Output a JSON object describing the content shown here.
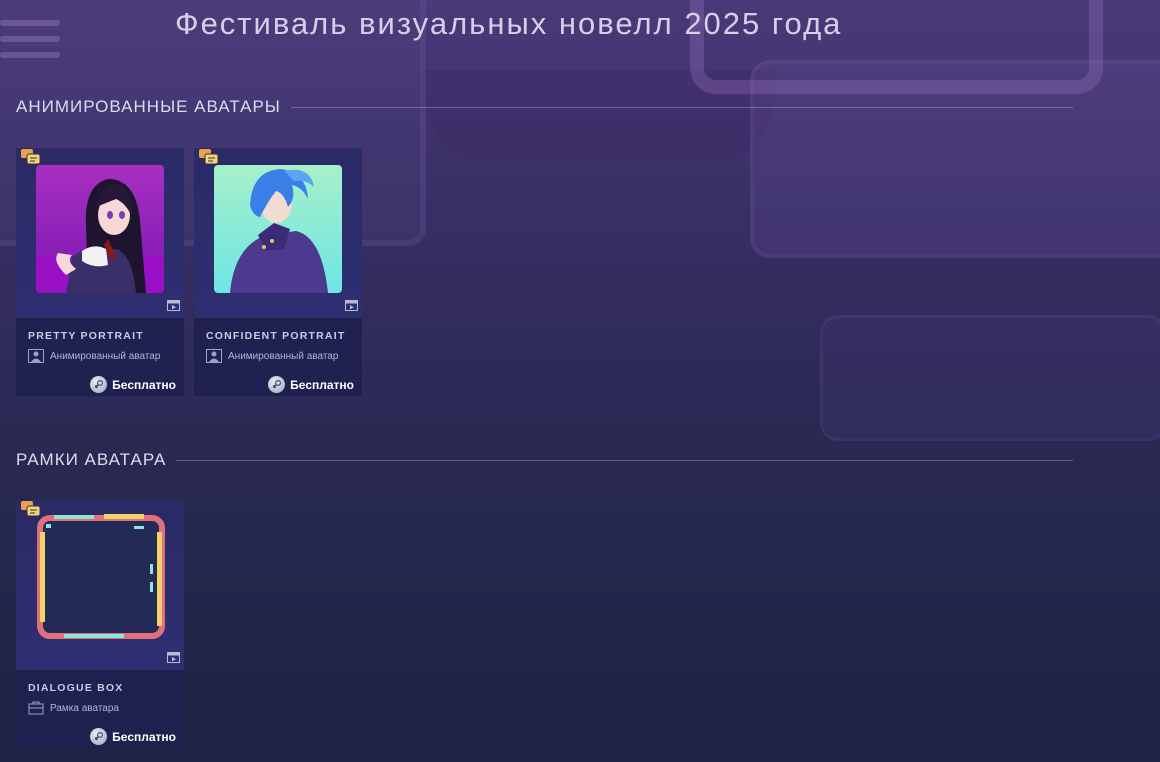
{
  "page": {
    "title": "Фестиваль визуальных новелл 2025 года"
  },
  "sections": [
    {
      "heading": "АНИМИРОВАННЫЕ АВАТАРЫ",
      "items": [
        {
          "name": "PRETTY PORTRAIT",
          "kind": "Анимированный аватар",
          "price": "Бесплатно",
          "icon": "animated-avatar-icon"
        },
        {
          "name": "CONFIDENT PORTRAIT",
          "kind": "Анимированный аватар",
          "price": "Бесплатно",
          "icon": "animated-avatar-icon"
        }
      ]
    },
    {
      "heading": "РАМКИ АВАТАРА",
      "items": [
        {
          "name": "DIALOGUE BOX",
          "kind": "Рамка аватара",
          "price": "Бесплатно",
          "icon": "avatar-frame-icon"
        }
      ]
    }
  ],
  "colors": {
    "accent_text": "#d4d0ea",
    "card_bg": "#24225a",
    "pink_avatar_bg": "#a020c8",
    "teal_avatar_bg": "#7ee8d8"
  }
}
